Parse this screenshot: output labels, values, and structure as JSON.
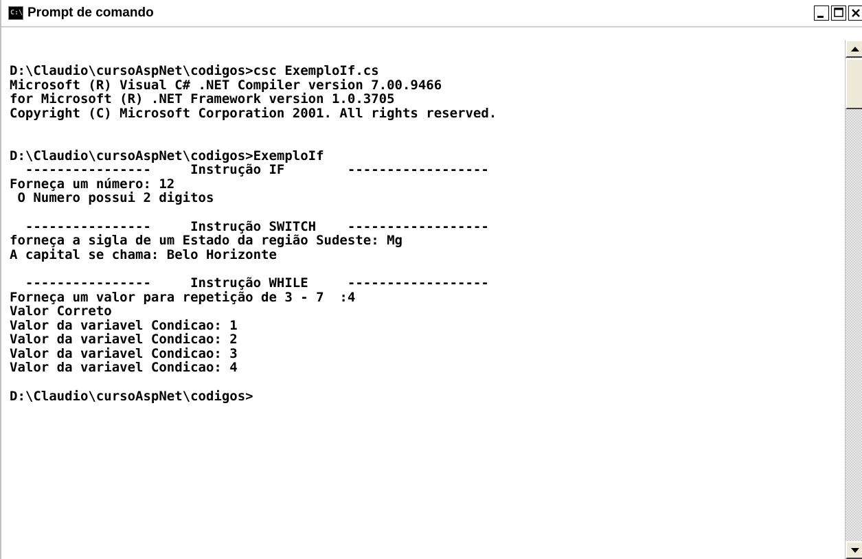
{
  "window": {
    "title": "Prompt de comando",
    "icon_label": "C:\\",
    "icon": "cmd-icon",
    "buttons": {
      "minimize": "minimize-icon",
      "maximize": "maximize-icon",
      "close": "close-icon"
    }
  },
  "console": {
    "lines": [
      "D:\\Claudio\\cursoAspNet\\codigos>csc ExemploIf.cs",
      "Microsoft (R) Visual C# .NET Compiler version 7.00.9466",
      "for Microsoft (R) .NET Framework version 1.0.3705",
      "Copyright (C) Microsoft Corporation 2001. All rights reserved.",
      "",
      "",
      "D:\\Claudio\\cursoAspNet\\codigos>ExemploIf",
      "  ----------------     Instrução IF        ------------------",
      "Forneça um número: 12",
      " O Numero possui 2 digitos",
      "",
      "  ----------------     Instrução SWITCH    ------------------",
      "forneça a sigla de um Estado da região Sudeste: Mg",
      "A capital se chama: Belo Horizonte",
      "",
      "  ----------------     Instrução WHILE     ------------------",
      "Forneça um valor para repetição de 3 - 7  :4",
      "Valor Correto",
      "Valor da variavel Condicao: 1",
      "Valor da variavel Condicao: 2",
      "Valor da variavel Condicao: 3",
      "Valor da variavel Condicao: 4",
      "",
      "D:\\Claudio\\cursoAspNet\\codigos>"
    ]
  },
  "colors": {
    "background": "#ffffff",
    "text": "#000000"
  }
}
